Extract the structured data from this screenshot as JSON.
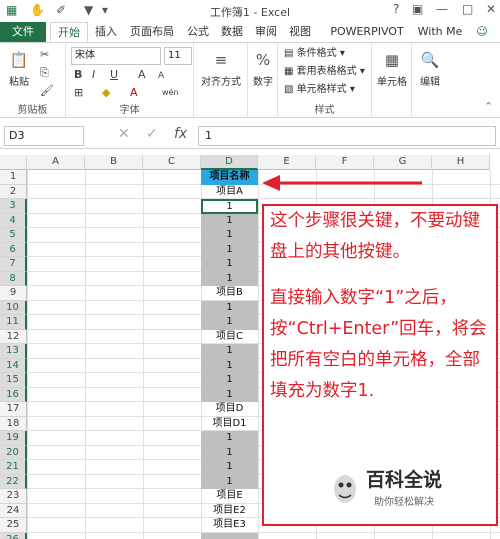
{
  "window": {
    "title": "工作簿1 - Excel",
    "controls": {
      "help": "?",
      "restore": "▣",
      "minimize": "—",
      "maximize": "□",
      "close": "✕"
    }
  },
  "quick_access": {
    "save": "💾",
    "undo": "↶",
    "redo": "↷",
    "touch": "✋",
    "eraser": "✐",
    "filter": "▼",
    "more": "▾"
  },
  "ribbon_tabs": [
    "文件",
    "开始",
    "插入",
    "页面布局",
    "公式",
    "数据",
    "审阅",
    "视图",
    "POWERPIVOT",
    "With Me"
  ],
  "active_tab": "开始",
  "ribbon": {
    "clipboard": {
      "paste": "粘贴",
      "label": "剪贴板"
    },
    "font": {
      "name": "宋体",
      "size": "11",
      "bold": "B",
      "italic": "I",
      "underline": "U",
      "grow": "A",
      "shrink": "A",
      "label": "字体",
      "wen": "wén"
    },
    "align": {
      "label": "对齐方式"
    },
    "number": {
      "label": "数字",
      "icon": "%"
    },
    "styles": {
      "conditional": "条件格式",
      "table": "套用表格格式",
      "cell_styles": "单元格样式",
      "label": "样式"
    },
    "cells": {
      "label": "单元格"
    },
    "editing": {
      "label": "编辑"
    }
  },
  "formula_bar": {
    "name_box": "D3",
    "cancel": "✕",
    "enter": "✓",
    "fx": "fx",
    "value": "1"
  },
  "columns": [
    "A",
    "B",
    "C",
    "D",
    "E",
    "F",
    "G",
    "H"
  ],
  "selected_column": "D",
  "rows": [
    "1",
    "2",
    "3",
    "4",
    "5",
    "6",
    "7",
    "8",
    "9",
    "10",
    "11",
    "12",
    "13",
    "14",
    "15",
    "16",
    "17",
    "18",
    "19",
    "20",
    "21",
    "22",
    "23",
    "24",
    "25",
    "26"
  ],
  "column_d": [
    {
      "text": "项目名称",
      "style": "hdr"
    },
    {
      "text": "项目A",
      "style": ""
    },
    {
      "text": "1",
      "style": "active"
    },
    {
      "text": "1",
      "style": "gray"
    },
    {
      "text": "1",
      "style": "gray"
    },
    {
      "text": "1",
      "style": "gray"
    },
    {
      "text": "1",
      "style": "gray"
    },
    {
      "text": "1",
      "style": "gray"
    },
    {
      "text": "项目B",
      "style": ""
    },
    {
      "text": "1",
      "style": "gray"
    },
    {
      "text": "1",
      "style": "gray"
    },
    {
      "text": "项目C",
      "style": ""
    },
    {
      "text": "1",
      "style": "gray"
    },
    {
      "text": "1",
      "style": "gray"
    },
    {
      "text": "1",
      "style": "gray"
    },
    {
      "text": "1",
      "style": "gray"
    },
    {
      "text": "项目D",
      "style": ""
    },
    {
      "text": "项目D1",
      "style": ""
    },
    {
      "text": "1",
      "style": "gray"
    },
    {
      "text": "1",
      "style": "gray"
    },
    {
      "text": "1",
      "style": "gray"
    },
    {
      "text": "1",
      "style": "gray"
    },
    {
      "text": "项目E",
      "style": ""
    },
    {
      "text": "项目E2",
      "style": ""
    },
    {
      "text": "项目E3",
      "style": ""
    },
    {
      "text": "",
      "style": "gray"
    }
  ],
  "annotation": {
    "para1": "这个步骤很关键，不要动键盘上的其他按键。",
    "para2": "直接输入数字“1”之后，按“Ctrl+Enter”回车，将会把所有空白的单元格，全部填充为数字1."
  },
  "watermark": {
    "title": "百科全说",
    "subtitle": "助你轻松解决"
  },
  "colors": {
    "excel_green": "#217346",
    "header_blue": "#29a8e0",
    "annotation_red": "#e0202a",
    "selected_gray": "#bfbfbf"
  }
}
